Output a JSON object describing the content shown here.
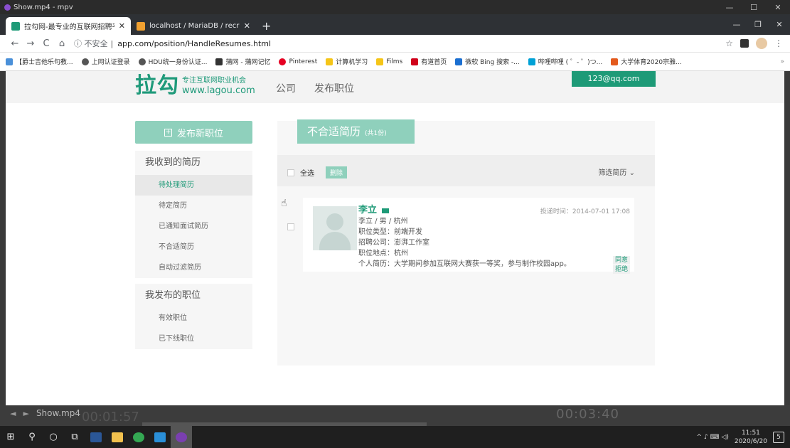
{
  "mpv": {
    "title": "Show.mp4 - mpv",
    "minimize": "—",
    "maximize": "☐",
    "close": "✕"
  },
  "browser": {
    "tabs": [
      {
        "title": "拉勾网-最专业的互联网招聘平台",
        "close": "✕",
        "color": "#1e9a77"
      },
      {
        "title": "localhost / MariaDB / recruit /",
        "close": "✕",
        "color": "#f0a030"
      }
    ],
    "new_tab": "+",
    "win_min": "—",
    "win_max": "❐",
    "win_close": "✕",
    "nav": {
      "back": "←",
      "forward": "→",
      "reload": "C",
      "home": "⌂"
    },
    "security": "ⓘ 不安全",
    "separator": "|",
    "url": "app.com/position/HandleResumes.html",
    "star": "☆",
    "menu": "⋮",
    "bookmarks": [
      {
        "label": "【爵士吉他乐句教...",
        "color": "#4a90d9"
      },
      {
        "label": "上网认证登录",
        "color": "#555555"
      },
      {
        "label": "HDU统一身份认证...",
        "color": "#555555"
      },
      {
        "label": "蒲网 - 蒲网记忆",
        "color": "#333333"
      },
      {
        "label": "Pinterest",
        "color": "#e60023"
      },
      {
        "label": "计算机学习",
        "color": "#f5c518"
      },
      {
        "label": "Films",
        "color": "#f5c518"
      },
      {
        "label": "有道首页",
        "color": "#d0021b"
      },
      {
        "label": "微软 Bing 搜索 -...",
        "color": "#1b6fd1"
      },
      {
        "label": "哔哩哔哩 ( ゜- ゜)つ...",
        "color": "#00a1d6"
      },
      {
        "label": "大学体育2020宗雅...",
        "color": "#e35a1e"
      }
    ],
    "bookmarks_more": "»"
  },
  "site": {
    "logo_main": "拉勾",
    "logo_sub1": "专注互联网职业机会",
    "logo_sub2": "www.lagou.com",
    "nav": [
      "公司",
      "发布职位"
    ],
    "user_email": "123@qq.com",
    "post_button": "发布新职位",
    "post_plus": "+",
    "received_heading": "我收到的简历",
    "received_items": [
      "待处理简历",
      "待定简历",
      "已通知面试简历",
      "不合适简历",
      "自动过滤简历"
    ],
    "posted_heading": "我发布的职位",
    "posted_items": [
      "有效职位",
      "已下线职位"
    ],
    "panel_title": "不合适简历",
    "panel_count": "(共1份)",
    "select_all": "全选",
    "delete": "删除",
    "filter": "筛选简历 ⌄",
    "cursor": "☝",
    "resume": {
      "name": "李立",
      "basic": "李立 / 男 / 杭州",
      "job_type": "职位类型：前端开发",
      "company": "招聘公司：澎湃工作室",
      "location": "职位地点：杭州",
      "intro": "个人简历：大学期间参加互联网大赛获一等奖，参与制作校园app。",
      "deliver_time": "投递时间：2014-07-01 17:08",
      "agree": "同意",
      "reject": "拒绝"
    }
  },
  "player": {
    "filename": "Show.mp4",
    "prev": "◄",
    "next": "►",
    "time_left": "00:01:57",
    "time_right": "00:03:40"
  },
  "taskbar": {
    "start": "⊞",
    "search": "⚲",
    "cortana": "○",
    "taskview": "⧉",
    "apps": [
      {
        "name": "word",
        "color": "#2b5797"
      },
      {
        "name": "explorer",
        "color": "#f2c14e"
      },
      {
        "name": "chrome",
        "color": "#34a853"
      },
      {
        "name": "vscode",
        "color": "#2a8fd8"
      },
      {
        "name": "mpv",
        "color": "#7a3fb0"
      }
    ],
    "tray": "^ ♪ ⌨ ◁)",
    "time": "11:51",
    "date": "2020/6/20",
    "notifications": "5"
  }
}
